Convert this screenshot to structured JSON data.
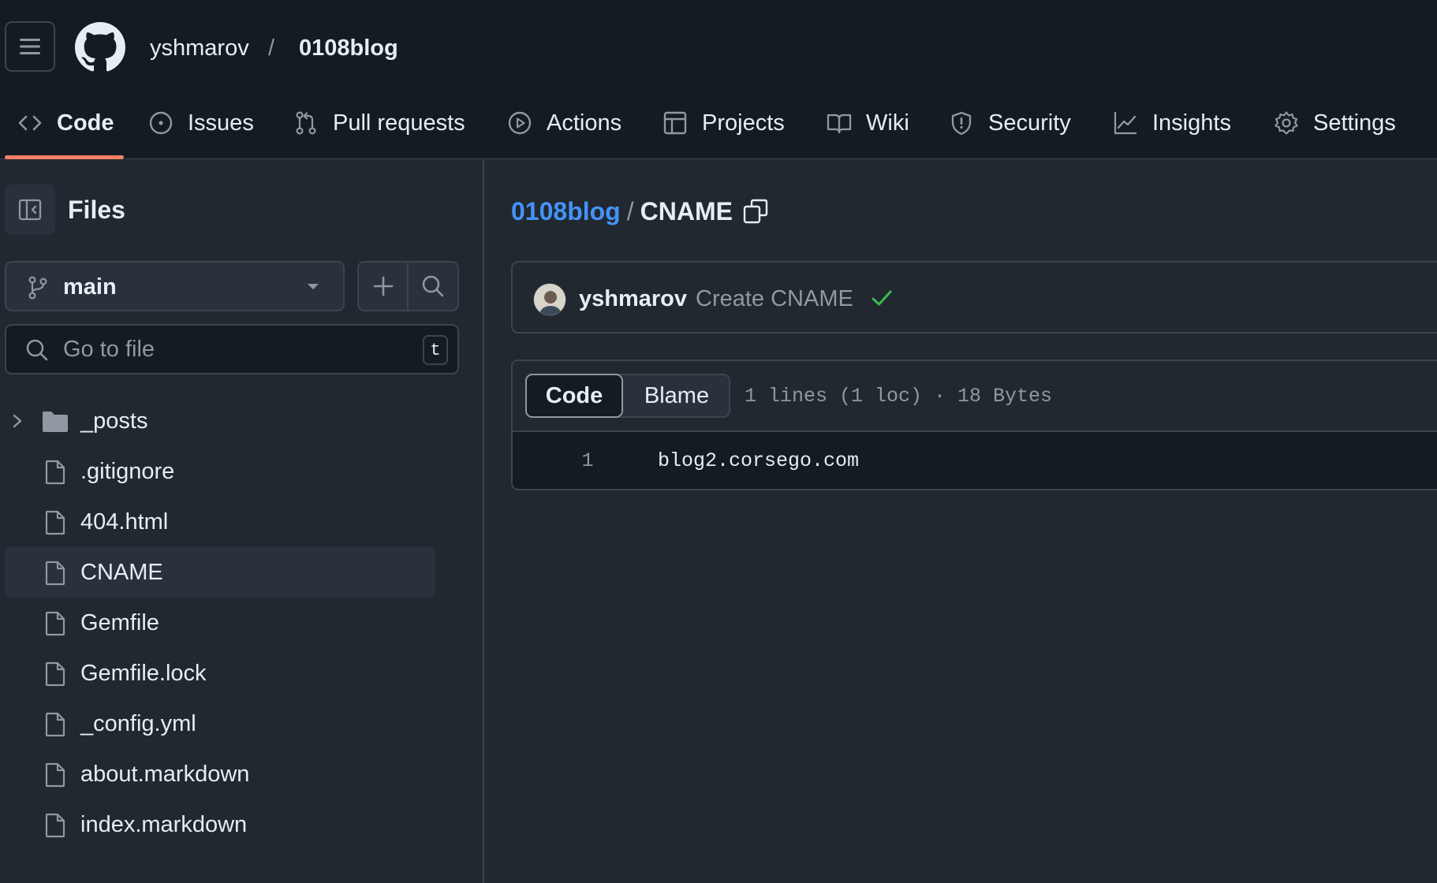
{
  "header": {
    "owner": "yshmarov",
    "separator": "/",
    "repo": "0108blog",
    "tabs": [
      {
        "label": "Code",
        "icon": "code-icon",
        "active": true
      },
      {
        "label": "Issues",
        "icon": "issue-opened-icon"
      },
      {
        "label": "Pull requests",
        "icon": "git-pull-request-icon"
      },
      {
        "label": "Actions",
        "icon": "play-icon"
      },
      {
        "label": "Projects",
        "icon": "table-icon"
      },
      {
        "label": "Wiki",
        "icon": "book-icon"
      },
      {
        "label": "Security",
        "icon": "shield-icon"
      },
      {
        "label": "Insights",
        "icon": "graph-icon"
      },
      {
        "label": "Settings",
        "icon": "gear-icon"
      }
    ]
  },
  "sidebar": {
    "title": "Files",
    "branch": "main",
    "goto_placeholder": "Go to file",
    "goto_shortcut": "t",
    "tree": [
      {
        "name": "_posts",
        "type": "folder"
      },
      {
        "name": ".gitignore",
        "type": "file"
      },
      {
        "name": "404.html",
        "type": "file"
      },
      {
        "name": "CNAME",
        "type": "file",
        "selected": true
      },
      {
        "name": "Gemfile",
        "type": "file"
      },
      {
        "name": "Gemfile.lock",
        "type": "file"
      },
      {
        "name": "_config.yml",
        "type": "file"
      },
      {
        "name": "about.markdown",
        "type": "file"
      },
      {
        "name": "index.markdown",
        "type": "file"
      }
    ]
  },
  "main": {
    "breadcrumb": {
      "repo": "0108blog",
      "separator": "/",
      "file": "CNAME"
    },
    "commit": {
      "author": "yshmarov",
      "message": "Create CNAME",
      "status": "success"
    },
    "viewer": {
      "tab_code": "Code",
      "tab_blame": "Blame",
      "info": "1 lines (1 loc) · 18 Bytes",
      "lines": [
        {
          "number": "1",
          "content": "blog2.corsego.com"
        }
      ]
    }
  },
  "colors": {
    "accent_link": "#4493f8",
    "tab_underline": "#f78166",
    "success": "#3fb950",
    "header_bg": "#151b23",
    "page_bg": "#212830"
  }
}
